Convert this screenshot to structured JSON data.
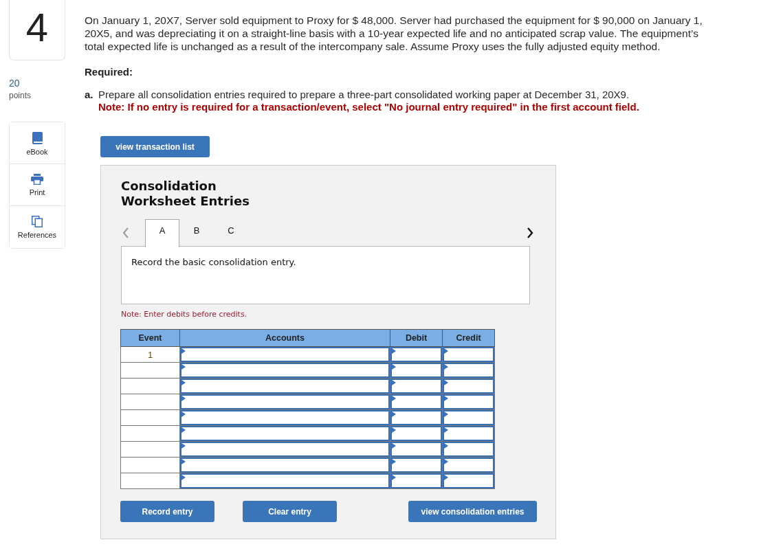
{
  "question": {
    "number": "4",
    "points": "20",
    "points_label": "points"
  },
  "tools": [
    {
      "kind": "ebook",
      "label": "eBook"
    },
    {
      "kind": "print",
      "label": "Print"
    },
    {
      "kind": "references",
      "label": "References"
    }
  ],
  "problem": {
    "text": "On January 1, 20X7, Server sold equipment to Proxy for $ 48,000. Server had purchased the equipment for $ 90,000 on January 1, 20X5, and was depreciating it on a straight-line basis with a 10-year expected life and no anticipated scrap value. The equipment’s total expected life is unchanged as a result of the intercompany sale. Assume Proxy uses the fully adjusted equity method.",
    "required_heading": "Required:",
    "parts": [
      {
        "label": "a.",
        "text": "Prepare all consolidation entries required to prepare a three-part consolidated working paper at December 31, 20X9.",
        "note": "Note: If no entry is required for a transaction/event, select \"No journal entry required\" in the first account field."
      }
    ]
  },
  "transaction_button": "view transaction list",
  "worksheet": {
    "title": "Consolidation Worksheet Entries",
    "pager": {
      "previous_disabled": true,
      "next_disabled": false
    },
    "tabs": [
      {
        "label": "A",
        "selected": true
      },
      {
        "label": "B",
        "selected": false
      },
      {
        "label": "C",
        "selected": false
      }
    ],
    "instruction": "Record the basic consolidation entry.",
    "note": "Note: Enter debits before credits.",
    "table": {
      "columns": [
        "Event",
        "Accounts",
        "Debit",
        "Credit"
      ],
      "rows": [
        {
          "event": "1"
        },
        {},
        {},
        {},
        {},
        {},
        {},
        {},
        {}
      ]
    },
    "buttons": [
      "Record entry",
      "Clear entry",
      "view consolidation entries"
    ]
  }
}
